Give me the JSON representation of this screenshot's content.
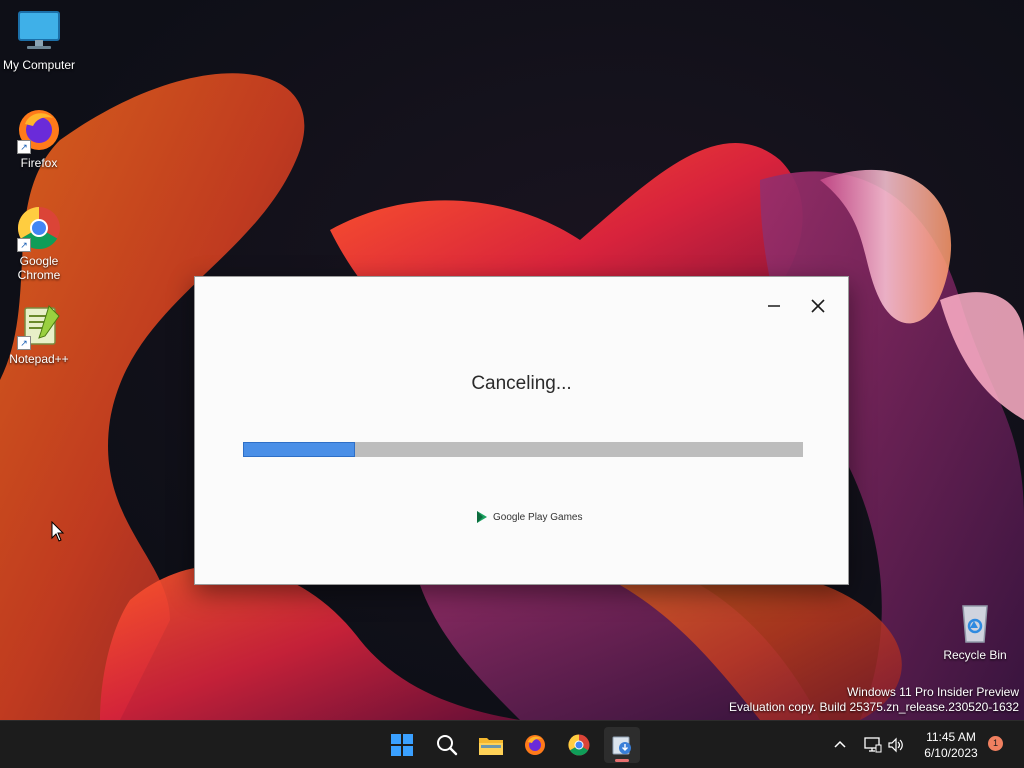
{
  "desktop": {
    "icons": [
      {
        "label": "My Computer",
        "icon": "monitor-icon"
      },
      {
        "label": "Firefox",
        "icon": "firefox-icon"
      },
      {
        "label": "Google\nChrome",
        "icon": "chrome-icon"
      },
      {
        "label": "Notepad++",
        "icon": "notepadpp-icon"
      }
    ],
    "recycle_bin": {
      "label": "Recycle Bin",
      "icon": "recycle-bin-icon"
    },
    "watermark": {
      "line1": "Windows 11 Pro Insider Preview",
      "line2": "Evaluation copy. Build 25375.zn_release.230520-1632"
    }
  },
  "dialog": {
    "status_text": "Canceling...",
    "progress_fraction": 0.2,
    "brand_text": "Google Play Games",
    "buttons": {
      "minimize": "minimize-icon",
      "close": "close-icon"
    },
    "colors": {
      "progress_fill": "#4a8fe7",
      "progress_track": "#bdbdbd",
      "brand_green": "#1aa260"
    }
  },
  "taskbar": {
    "apps": [
      {
        "name": "Start",
        "icon": "windows-logo-icon"
      },
      {
        "name": "Search",
        "icon": "search-icon"
      },
      {
        "name": "File Explorer",
        "icon": "folder-icon"
      },
      {
        "name": "Firefox",
        "icon": "firefox-icon"
      },
      {
        "name": "Chrome",
        "icon": "chrome-icon"
      },
      {
        "name": "Google Play Games installer",
        "icon": "installer-icon",
        "active": true
      }
    ],
    "tray": {
      "chevron": "chevron-up-icon",
      "network": "network-icon",
      "volume": "volume-icon",
      "time": "11:45 AM",
      "date": "6/10/2023",
      "notification_count": "1"
    }
  }
}
